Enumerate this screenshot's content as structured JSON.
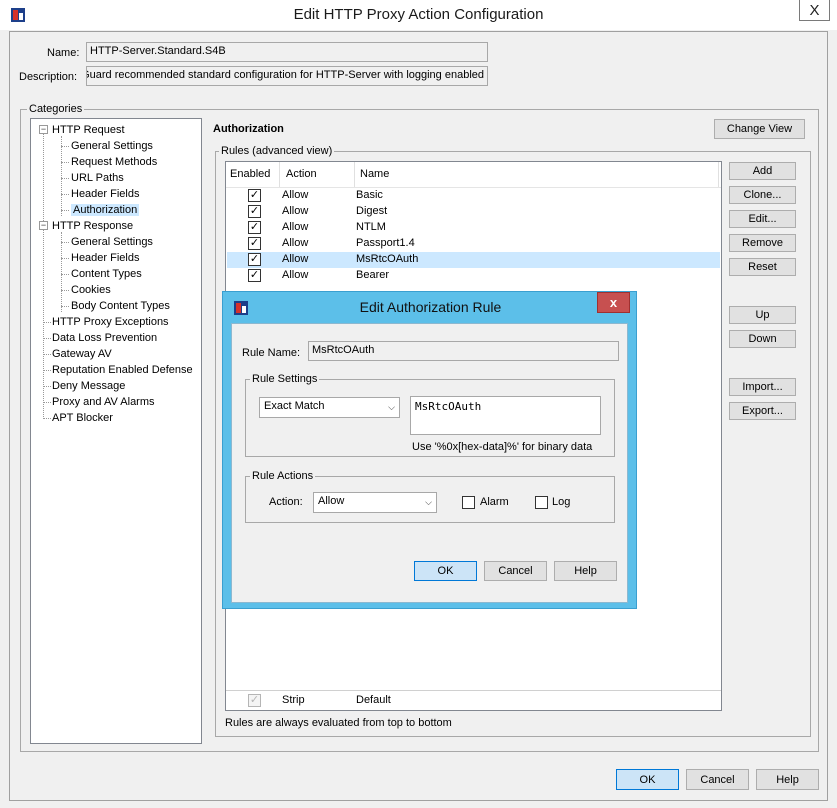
{
  "window": {
    "title": "Edit HTTP Proxy Action Configuration",
    "close_glyph": "X"
  },
  "form": {
    "name_label": "Name:",
    "name_value": "HTTP-Server.Standard.S4B",
    "description_label": "Description:",
    "description_value": "Guard recommended standard configuration for HTTP-Server with logging enabled"
  },
  "categories": {
    "label": "Categories",
    "tree": [
      {
        "label": "HTTP Request",
        "level": 0,
        "expander": "−"
      },
      {
        "label": "General Settings",
        "level": 1
      },
      {
        "label": "Request Methods",
        "level": 1
      },
      {
        "label": "URL Paths",
        "level": 1
      },
      {
        "label": "Header Fields",
        "level": 1
      },
      {
        "label": "Authorization",
        "level": 1,
        "selected": true
      },
      {
        "label": "HTTP Response",
        "level": 0,
        "expander": "−"
      },
      {
        "label": "General Settings",
        "level": 1
      },
      {
        "label": "Header Fields",
        "level": 1
      },
      {
        "label": "Content Types",
        "level": 1
      },
      {
        "label": "Cookies",
        "level": 1
      },
      {
        "label": "Body Content Types",
        "level": 1
      },
      {
        "label": "HTTP Proxy Exceptions",
        "level": 0
      },
      {
        "label": "Data Loss Prevention",
        "level": 0
      },
      {
        "label": "Gateway AV",
        "level": 0
      },
      {
        "label": "Reputation Enabled Defense",
        "level": 0
      },
      {
        "label": "Deny Message",
        "level": 0
      },
      {
        "label": "Proxy and AV Alarms",
        "level": 0
      },
      {
        "label": "APT Blocker",
        "level": 0
      }
    ]
  },
  "authorization": {
    "heading": "Authorization",
    "change_view": "Change View",
    "rules_label": "Rules (advanced view)",
    "columns": {
      "enabled": "Enabled",
      "action": "Action",
      "name": "Name"
    },
    "rows": [
      {
        "enabled": true,
        "action": "Allow",
        "name": "Basic"
      },
      {
        "enabled": true,
        "action": "Allow",
        "name": "Digest"
      },
      {
        "enabled": true,
        "action": "Allow",
        "name": "NTLM"
      },
      {
        "enabled": true,
        "action": "Allow",
        "name": "Passport1.4"
      },
      {
        "enabled": true,
        "action": "Allow",
        "name": "MsRtcOAuth",
        "selected": true
      },
      {
        "enabled": true,
        "action": "Allow",
        "name": "Bearer"
      }
    ],
    "default_row": {
      "action": "Strip",
      "name": "Default"
    },
    "footer_note": "Rules are always evaluated from top to bottom",
    "side_buttons": {
      "add": "Add",
      "clone": "Clone...",
      "edit": "Edit...",
      "remove": "Remove",
      "reset": "Reset",
      "up": "Up",
      "down": "Down",
      "import": "Import...",
      "export": "Export..."
    }
  },
  "bottom_buttons": {
    "ok": "OK",
    "cancel": "Cancel",
    "help": "Help"
  },
  "dialog": {
    "title": "Edit Authorization Rule",
    "close_glyph": "x",
    "rule_name_label": "Rule Name:",
    "rule_name_value": "MsRtcOAuth",
    "rule_settings_label": "Rule Settings",
    "match_type": "Exact Match",
    "pattern": "MsRtcOAuth",
    "hint": "Use '%0x[hex-data]%' for binary data",
    "rule_actions_label": "Rule Actions",
    "action_label": "Action:",
    "action_value": "Allow",
    "alarm_label": "Alarm",
    "log_label": "Log",
    "ok": "OK",
    "cancel": "Cancel",
    "help": "Help"
  },
  "colors": {
    "dialog_frame": "#5cbfe9",
    "selection": "#cce8ff",
    "close_red": "#c75050"
  }
}
